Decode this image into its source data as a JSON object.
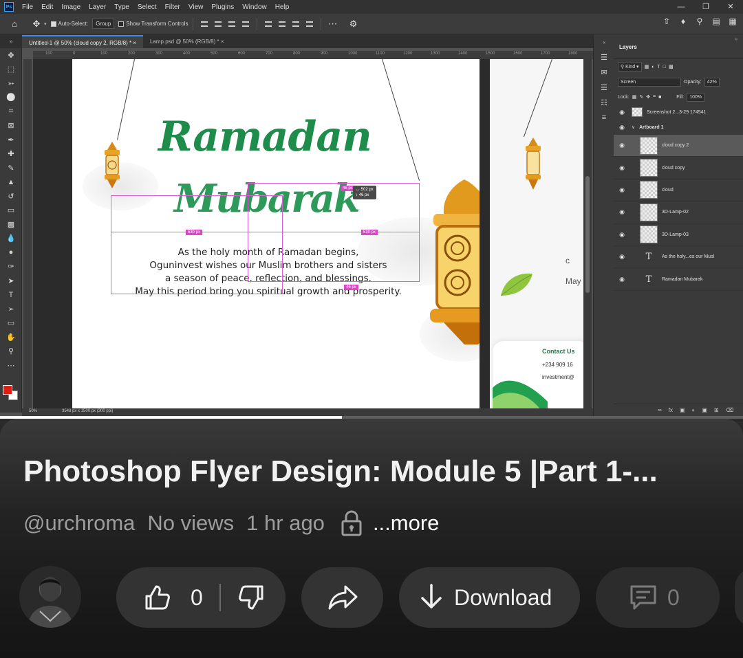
{
  "photoshop": {
    "logo": "Ps",
    "menus": [
      "File",
      "Edit",
      "Image",
      "Layer",
      "Type",
      "Select",
      "Filter",
      "View",
      "Plugins",
      "Window",
      "Help"
    ],
    "options": {
      "auto_select_label": "Auto-Select:",
      "auto_select_value": "Group",
      "show_transform_label": "Show Transform Controls"
    },
    "tabs": [
      "Untitled-1 @ 50% (cloud copy 2, RGB/8) *",
      "Lamp.psd @ 50% (RGB/8) *"
    ],
    "ruler_numbers": [
      "100",
      "0",
      "100",
      "200",
      "300",
      "400",
      "500",
      "600",
      "700",
      "800",
      "900",
      "1000",
      "1100",
      "1200",
      "1300",
      "1400",
      "1500",
      "1600",
      "1700",
      "1800"
    ],
    "artboard": {
      "title_line1": "Ramadan",
      "title_line2": "Mubarak",
      "body_lines": [
        "As the holy month of Ramadan begins,",
        "Oguninvest wishes our Muslim brothers and sisters",
        "a season of peace, reflection, and blessings.",
        "May this period bring you spiritual growth and prosperity."
      ],
      "measure_tags": [
        "46 px",
        "530 px",
        "530 px",
        "46 px"
      ],
      "tooltip_lines": [
        "↔ 502 px",
        "↕ 46 px"
      ]
    },
    "artboard2": {
      "may_text": "May",
      "letter_c": "c",
      "contact_title": "Contact Us",
      "contact_phone": "+234 909 16",
      "contact_email": "investment@"
    },
    "status": {
      "zoom": "50%",
      "doc_info": "3548 px x 1500 px (300 ppi)"
    },
    "layers_panel": {
      "tab_label": "Layers",
      "kind_label": "Kind",
      "blend_mode": "Screen",
      "opacity_label": "Opacity:",
      "opacity_value": "42%",
      "lock_label": "Lock:",
      "fill_label": "Fill:",
      "fill_value": "100%",
      "top_layer": "Screenshot 2...3-29 174541",
      "group_name": "Artboard 1",
      "layers": [
        {
          "name": "cloud copy 2",
          "kind": "image",
          "selected": true
        },
        {
          "name": "cloud copy",
          "kind": "image",
          "selected": false
        },
        {
          "name": "cloud",
          "kind": "image",
          "selected": false
        },
        {
          "name": "3D-Lamp-02",
          "kind": "image",
          "selected": false
        },
        {
          "name": "3D-Lamp-03",
          "kind": "image",
          "selected": false
        },
        {
          "name": "As the holy...es our Musl",
          "kind": "text",
          "selected": false
        },
        {
          "name": "Ramadan Mubarak",
          "kind": "text",
          "selected": false
        }
      ]
    }
  },
  "youtube": {
    "progress_fraction": 0.46,
    "title": "Photoshop Flyer Design: Module 5 |Part 1-...",
    "channel": "@urchroma",
    "views": "No views",
    "age": "1 hr ago",
    "more": "...more",
    "likes": "0",
    "download_label": "Download",
    "comments": "0"
  },
  "colors": {
    "ps_bg": "#535353",
    "accent_green": "#1e8c4a",
    "guide_magenta": "#d946c8",
    "yt_pill": "#333333"
  }
}
